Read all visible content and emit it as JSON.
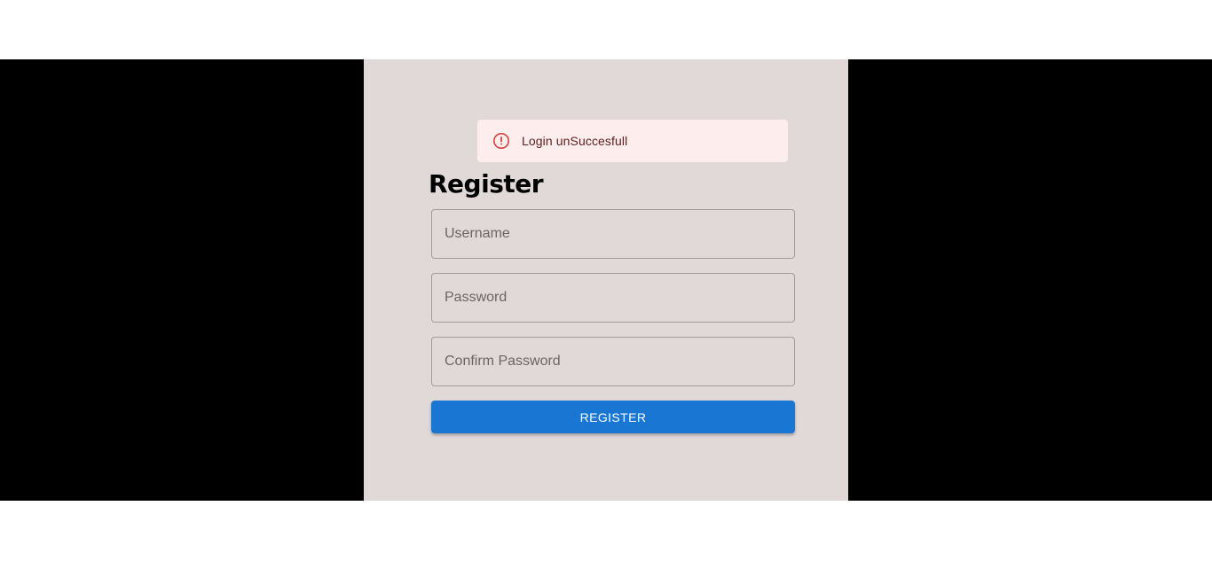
{
  "alert": {
    "message": "Login unSuccesfull",
    "icon": "error-outline-icon",
    "icon_color": "#d74141",
    "background": "#fdeded"
  },
  "form": {
    "title": "Register",
    "username_placeholder": "Username",
    "password_placeholder": "Password",
    "confirm_password_placeholder": "Confirm Password",
    "submit_label": "REGISTER"
  },
  "colors": {
    "card_background": "#e1d8d8",
    "side_background": "#000000",
    "primary": "#1976d2"
  }
}
